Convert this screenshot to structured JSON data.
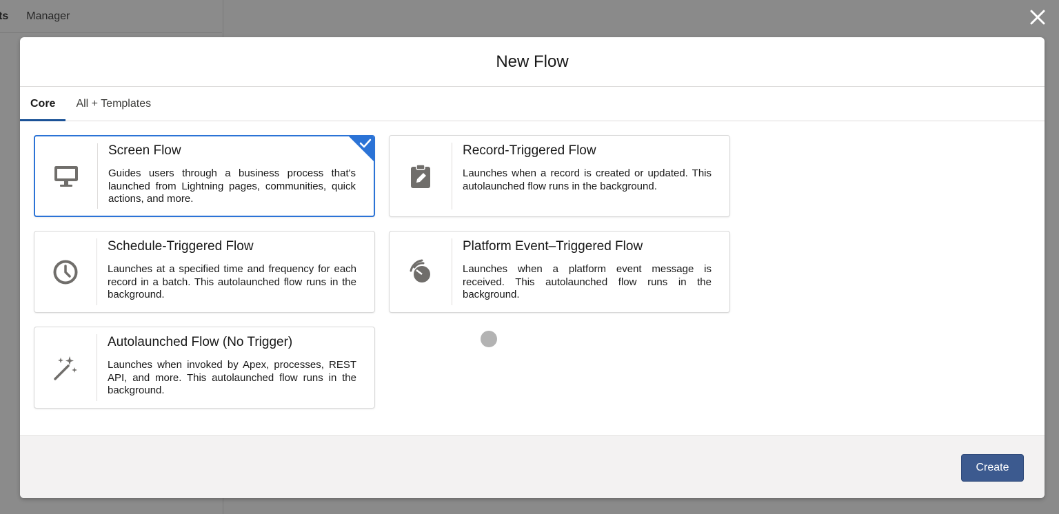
{
  "background": {
    "tab_partial": "ts",
    "tab_manager": "Manager"
  },
  "modal": {
    "title": "New Flow",
    "tabs": [
      {
        "label": "Core",
        "active": true
      },
      {
        "label": "All + Templates",
        "active": false
      }
    ],
    "cards": [
      {
        "title": "Screen Flow",
        "description": "Guides users through a business process that's launched from Lightning pages, communities, quick actions, and more.",
        "icon": "desktop-icon",
        "selected": true
      },
      {
        "title": "Record-Triggered Flow",
        "description": "Launches when a record is created or updated. This autolaunched flow runs in the background.",
        "icon": "record-clipboard-icon",
        "selected": false
      },
      {
        "title": "Schedule-Triggered Flow",
        "description": "Launches at a specified time and frequency for each record in a batch. This autolaunched flow runs in the background.",
        "icon": "clock-icon",
        "selected": false
      },
      {
        "title": "Platform Event–Triggered Flow",
        "description": "Launches when a platform event message is received. This autolaunched flow runs in the background.",
        "icon": "platform-event-icon",
        "selected": false
      },
      {
        "title": "Autolaunched Flow (No Trigger)",
        "description": "Launches when invoked by Apex, processes, REST API, and more. This autolaunched flow runs in the background.",
        "icon": "magic-wand-icon",
        "selected": false
      }
    ],
    "footer": {
      "create_label": "Create"
    }
  },
  "colors": {
    "accent": "#2b73d6",
    "brand_button": "#3c5a8f",
    "tab_underline": "#1b5297",
    "overlay": "#8a8a8a"
  }
}
